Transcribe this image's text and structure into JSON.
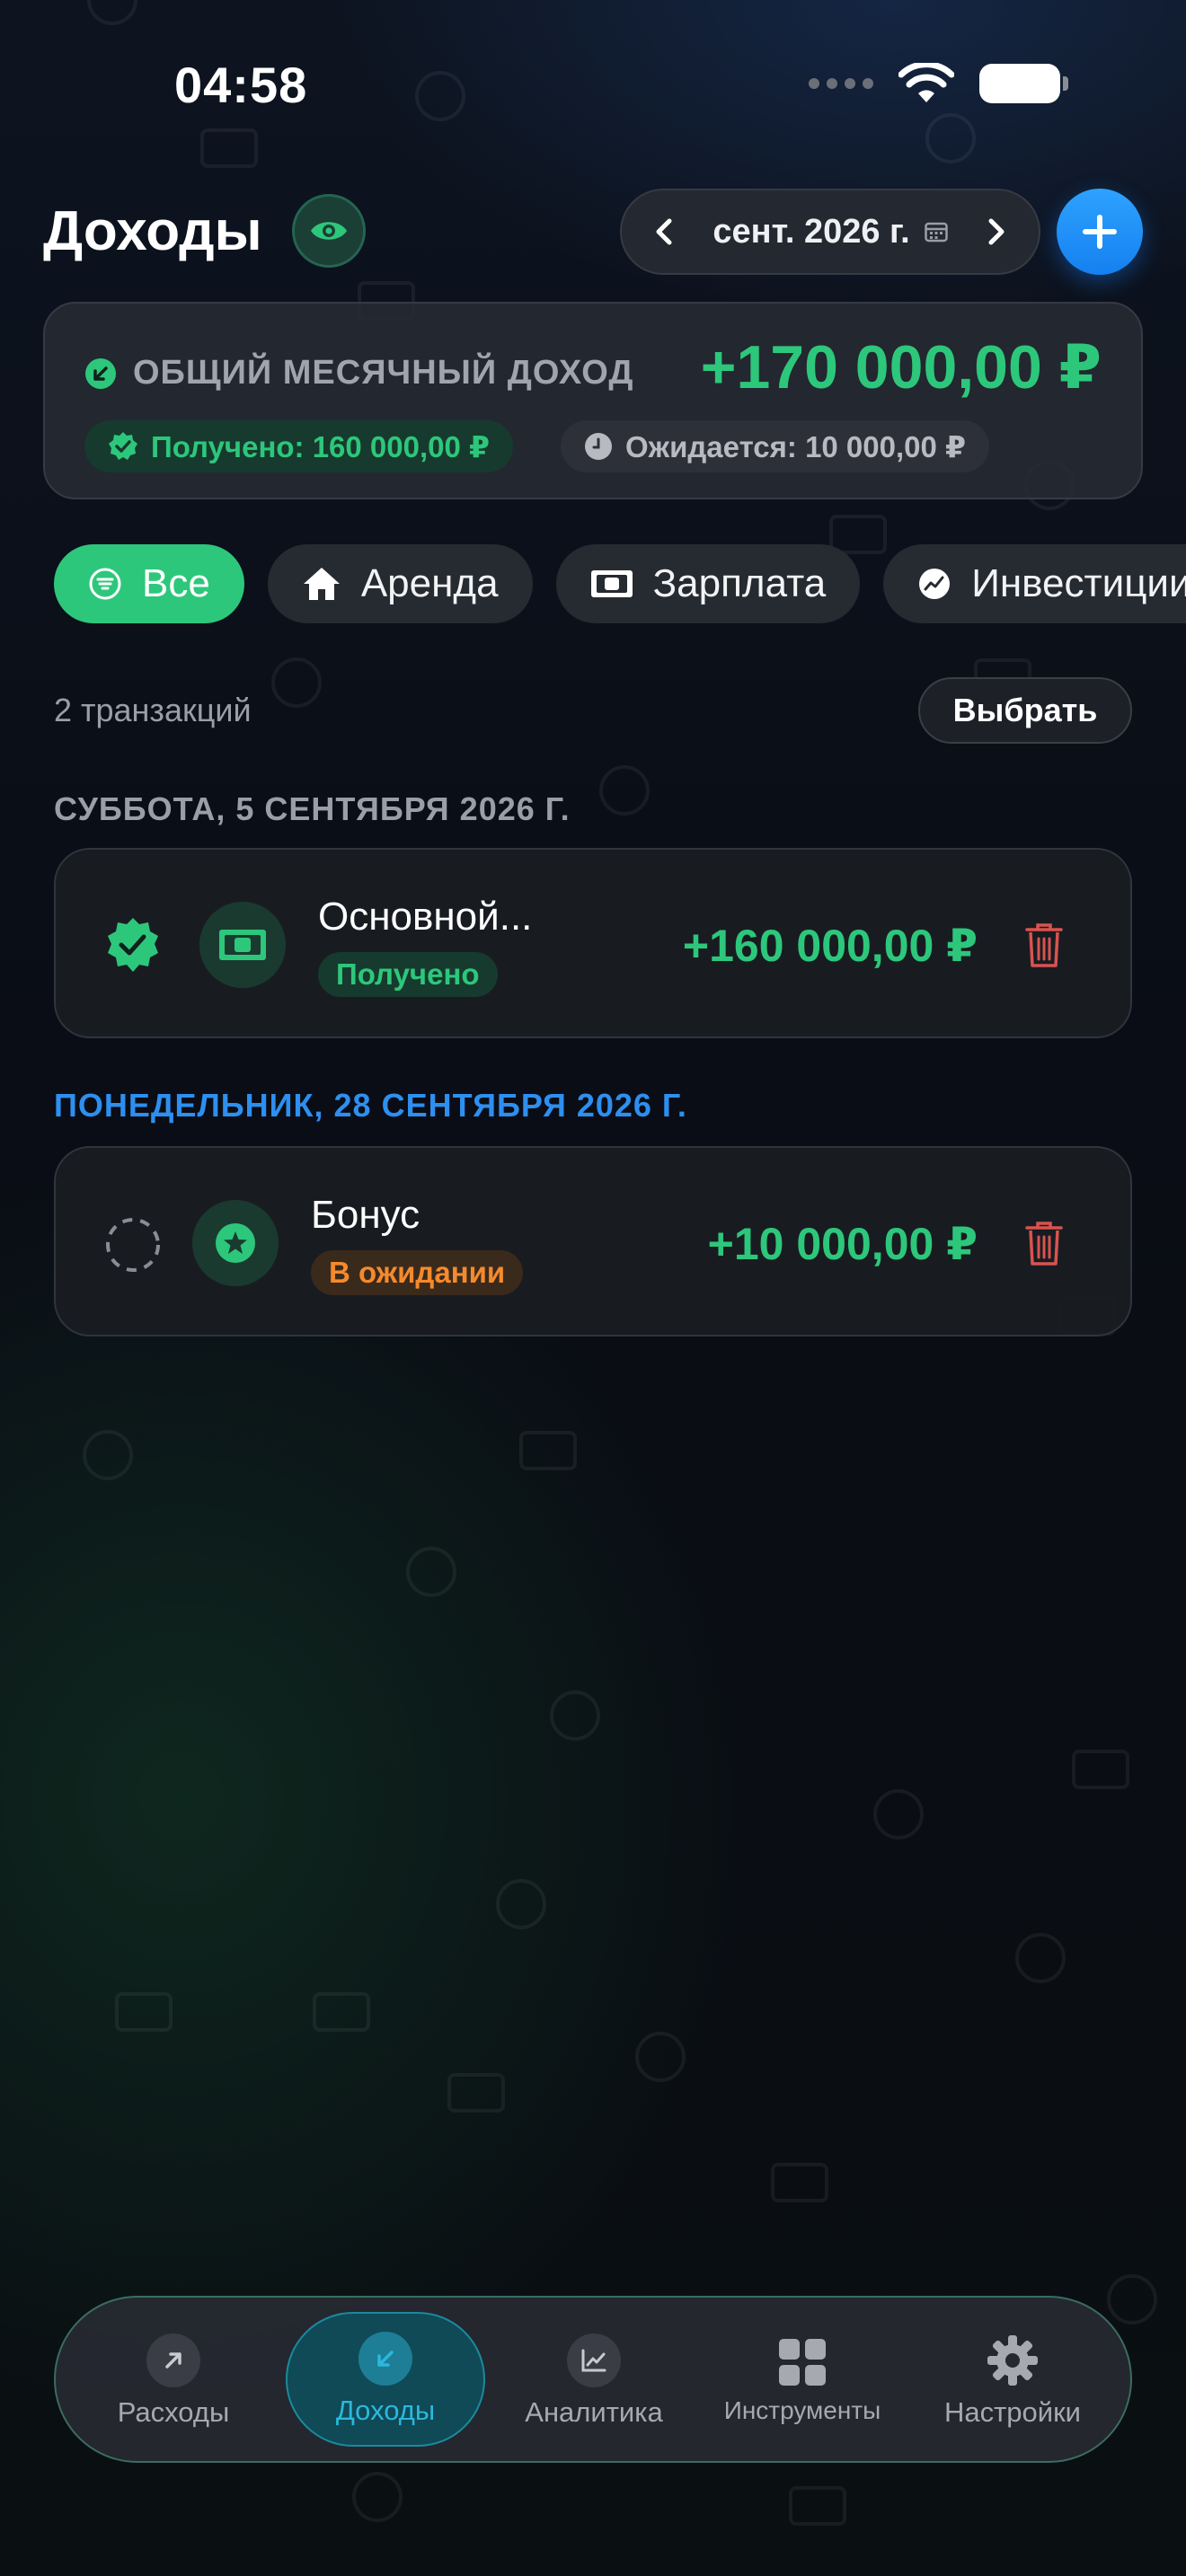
{
  "status_bar": {
    "time": "04:58"
  },
  "header": {
    "title": "Доходы",
    "month_label": "сент. 2026 г."
  },
  "summary": {
    "label": "ОБЩИЙ МЕСЯЧНЫЙ ДОХОД",
    "total": "+170 000,00 ₽",
    "received": "Получено: 160 000,00 ₽",
    "expected": "Ожидается: 10 000,00 ₽"
  },
  "filters": [
    {
      "label": "Все",
      "icon": "list-filter-icon",
      "active": true
    },
    {
      "label": "Аренда",
      "icon": "house-icon",
      "active": false
    },
    {
      "label": "Зарплата",
      "icon": "banknote-icon",
      "active": false
    },
    {
      "label": "Инвестиции",
      "icon": "chart-icon",
      "active": false
    }
  ],
  "list": {
    "count": "2 транзакций",
    "select_label": "Выбрать"
  },
  "groups": [
    {
      "date": "СУББОТА, 5 СЕНТЯБРЯ 2026 Г.",
      "tx": {
        "name": "Основной...",
        "status": "Получено",
        "amount": "+160 000,00 ₽",
        "icon": "banknote-icon"
      }
    },
    {
      "date": "ПОНЕДЕЛЬНИК, 28 СЕНТЯБРЯ 2026 Г.",
      "tx": {
        "name": "Бонус",
        "status": "В ожидании",
        "amount": "+10 000,00 ₽",
        "icon": "star-badge-icon"
      }
    }
  ],
  "tabs": [
    {
      "label": "Расходы",
      "icon": "arrow-up-right-icon"
    },
    {
      "label": "Доходы",
      "icon": "arrow-down-left-icon",
      "active": true
    },
    {
      "label": "Аналитика",
      "icon": "chart-line-icon"
    },
    {
      "label": "Инструменты",
      "icon": "grid-icon"
    },
    {
      "label": "Настройки",
      "icon": "gear-icon"
    }
  ],
  "colors": {
    "accent_green": "#2dc77b",
    "accent_blue": "#1580f0",
    "pending_orange": "#f58a2c",
    "delete_red": "#d9534f"
  }
}
